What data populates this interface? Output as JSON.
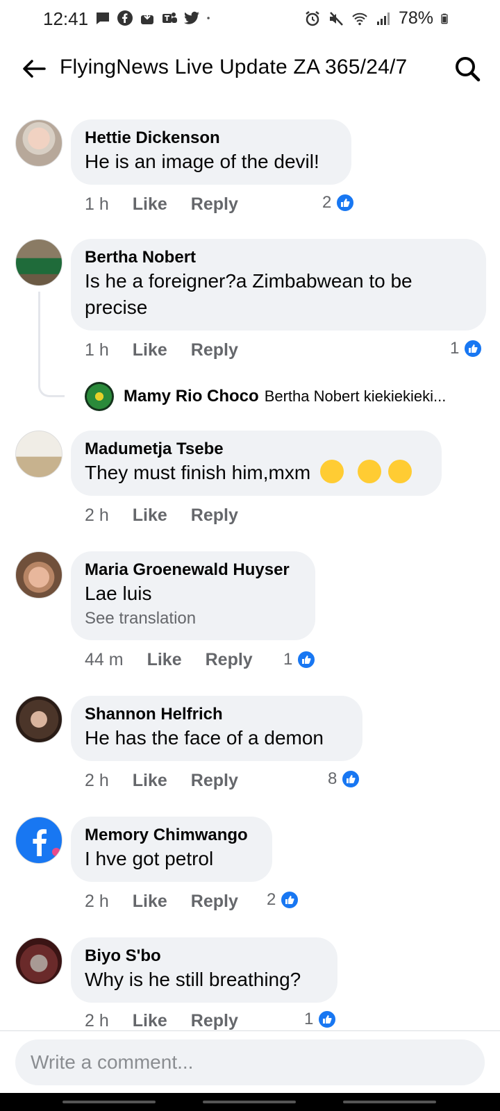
{
  "status_bar": {
    "time": "12:41",
    "left_icons": [
      "message-icon",
      "facebook-icon",
      "download-icon",
      "teams-icon",
      "twitter-icon",
      "dot-icon"
    ],
    "right_icons": [
      "alarm-icon",
      "mute-icon",
      "wifi-icon",
      "signal-icon"
    ],
    "battery": "78%"
  },
  "header": {
    "title": "FlyingNews Live Update ZA 365/24/7"
  },
  "comments": [
    {
      "author": "Hettie Dickenson",
      "text": "He is an image of the devil!",
      "time": "1 h",
      "like_label": "Like",
      "reply_label": "Reply",
      "reactions": "2"
    },
    {
      "author": "Bertha Nobert",
      "text": "Is he a foreigner?a Zimbabwean to be precise",
      "time": "1 h",
      "like_label": "Like",
      "reply_label": "Reply",
      "reactions": "1",
      "reply": {
        "author": "Mamy Rio Choco",
        "snippet": "Bertha Nobert kiekiekieki..."
      }
    },
    {
      "author": "Madumetja Tsebe",
      "text": "They must finish him,mxm",
      "time": "2 h",
      "like_label": "Like",
      "reply_label": "Reply"
    },
    {
      "author": "Maria Groenewald Huyser",
      "text": "Lae luis",
      "see_translation": "See translation",
      "time": "44 m",
      "like_label": "Like",
      "reply_label": "Reply",
      "reactions": "1"
    },
    {
      "author": "Shannon Helfrich",
      "text": "He has the face of a demon",
      "time": "2 h",
      "like_label": "Like",
      "reply_label": "Reply",
      "reactions": "8"
    },
    {
      "author": "Memory Chimwango",
      "text": "I hve got petrol",
      "time": "2 h",
      "like_label": "Like",
      "reply_label": "Reply",
      "reactions": "2"
    },
    {
      "author": "Biyo S'bo",
      "text": "Why is he still breathing?",
      "time": "2 h",
      "like_label": "Like",
      "reply_label": "Reply",
      "reactions": "1"
    }
  ],
  "composer": {
    "placeholder": "Write a comment..."
  },
  "colors": {
    "bubble": "#f0f2f5",
    "like_blue": "#1877f2",
    "meta_gray": "#65676b"
  }
}
